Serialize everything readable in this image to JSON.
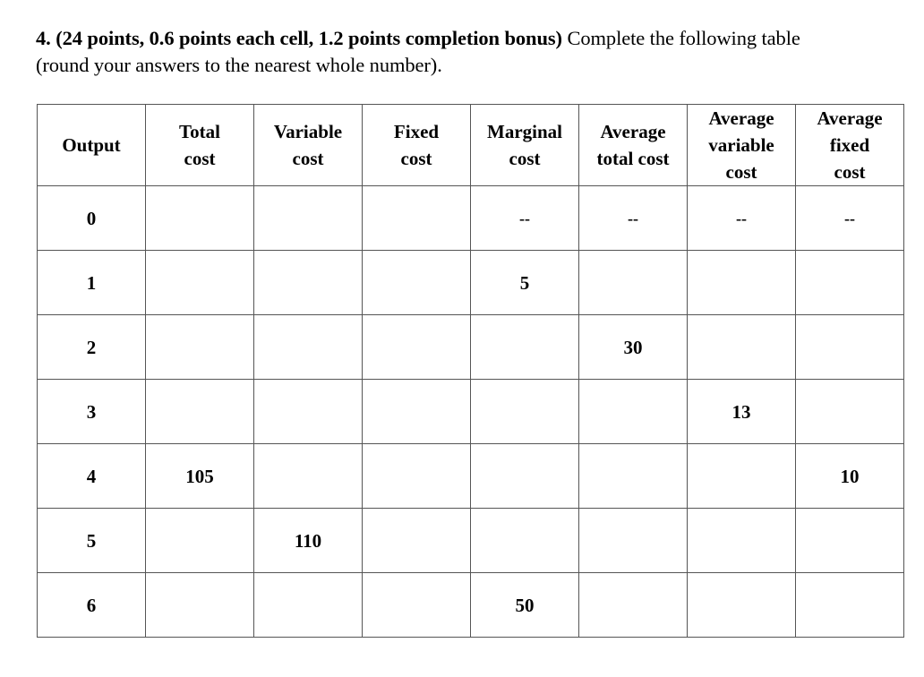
{
  "question": {
    "number_and_points": "4. (24 points, 0.6 points each cell, 1.2 points completion bonus)",
    "instruction_line1": " Complete the following table",
    "instruction_line2": "(round your answers to the nearest whole number)."
  },
  "table": {
    "headers": [
      [
        "Output"
      ],
      [
        "Total",
        "cost"
      ],
      [
        "Variable",
        "cost"
      ],
      [
        "Fixed",
        "cost"
      ],
      [
        "Marginal",
        "cost"
      ],
      [
        "Average",
        "total cost"
      ],
      [
        "Average",
        "variable",
        "cost"
      ],
      [
        "Average",
        "fixed",
        "cost"
      ]
    ],
    "rows": [
      [
        "0",
        "",
        "",
        "",
        "--",
        "--",
        "--",
        "--"
      ],
      [
        "1",
        "",
        "",
        "",
        "5",
        "",
        "",
        ""
      ],
      [
        "2",
        "",
        "",
        "",
        "",
        "30",
        "",
        ""
      ],
      [
        "3",
        "",
        "",
        "",
        "",
        "",
        "13",
        ""
      ],
      [
        "4",
        "105",
        "",
        "",
        "",
        "",
        "",
        "10"
      ],
      [
        "5",
        "",
        "110",
        "",
        "",
        "",
        "",
        ""
      ],
      [
        "6",
        "",
        "",
        "",
        "50",
        "",
        "",
        ""
      ]
    ]
  }
}
